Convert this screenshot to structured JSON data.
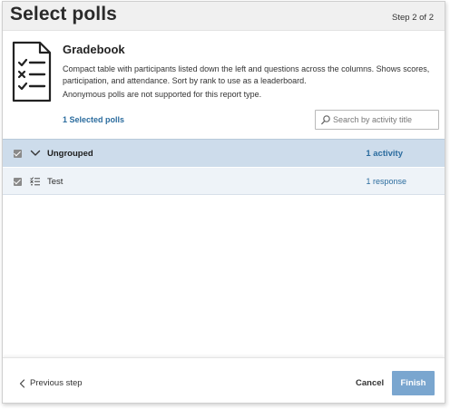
{
  "header": {
    "title": "Select polls",
    "step": "Step 2 of 2"
  },
  "report": {
    "name": "Gradebook",
    "description": "Compact table with participants listed down the left and questions across the columns. Shows scores, participation, and attendance. Sort by rank to use as a leaderboard.",
    "note": "Anonymous polls are not supported for this report type.",
    "icon": "checklist-document-icon"
  },
  "selection": {
    "selected_label": "1 Selected polls"
  },
  "search": {
    "placeholder": "Search by activity title",
    "value": ""
  },
  "groups": [
    {
      "name": "Ungrouped",
      "count": "1 activity",
      "checked": true,
      "expanded": true,
      "items": [
        {
          "name": "Test",
          "responses": "1 response",
          "checked": true,
          "icon": "list-poll-icon"
        }
      ]
    }
  ],
  "footer": {
    "previous_label": "Previous step",
    "cancel_label": "Cancel",
    "finish_label": "Finish"
  },
  "colors": {
    "accent": "#2b6c9e",
    "group_row_bg": "#cddceb",
    "item_row_bg": "#eef3f8",
    "finish_button_bg": "#7aa6cf",
    "header_bg": "#f0f0f0"
  }
}
